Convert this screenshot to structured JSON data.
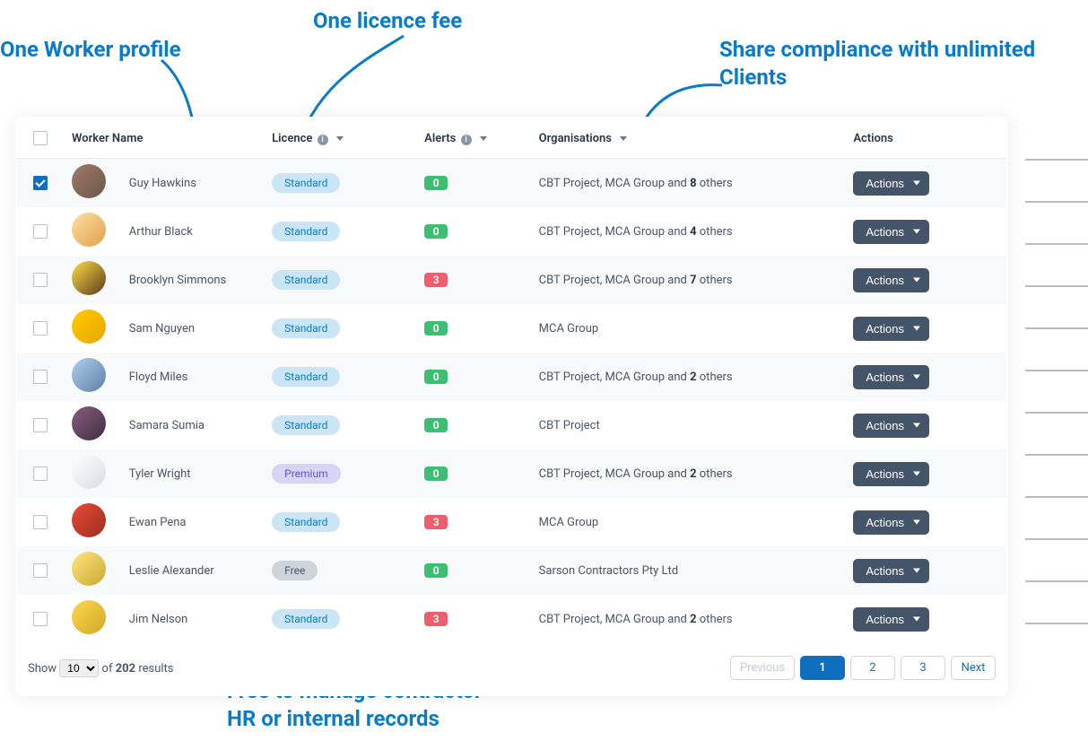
{
  "annotations": {
    "worker_profile": "One Worker profile",
    "licence_fee": "One licence fee",
    "share": "Share compliance with unlimited Clients",
    "free_line1": "Free to manage contractor",
    "free_line2": "HR or internal records"
  },
  "columns": {
    "name": "Worker Name",
    "licence": "Licence",
    "alerts": "Alerts",
    "orgs": "Organisations",
    "actions": "Actions"
  },
  "labels": {
    "actions_btn": "Actions",
    "show": "Show",
    "of": "of",
    "results": "results",
    "prev": "Previous",
    "next": "Next"
  },
  "licence_text": {
    "standard": "Standard",
    "premium": "Premium",
    "free": "Free"
  },
  "footer": {
    "page_size": "10",
    "total": "202",
    "pages": [
      "1",
      "2",
      "3"
    ]
  },
  "rows": [
    {
      "checked": true,
      "avatar": "av1",
      "name": "Guy Hawkins",
      "licence": "standard",
      "alerts": "0",
      "alert_style": "green",
      "org_prefix": "CBT Project, MCA Group and ",
      "org_bold": "8",
      "org_suffix": " others"
    },
    {
      "checked": false,
      "avatar": "av2",
      "name": "Arthur Black",
      "licence": "standard",
      "alerts": "0",
      "alert_style": "green",
      "org_prefix": "CBT Project, MCA Group and ",
      "org_bold": "4",
      "org_suffix": " others"
    },
    {
      "checked": false,
      "avatar": "av3",
      "name": "Brooklyn Simmons",
      "licence": "standard",
      "alerts": "3",
      "alert_style": "red",
      "org_prefix": "CBT Project, MCA Group and ",
      "org_bold": "7",
      "org_suffix": " others"
    },
    {
      "checked": false,
      "avatar": "av4",
      "name": "Sam Nguyen",
      "licence": "standard",
      "alerts": "0",
      "alert_style": "green",
      "org_prefix": "MCA Group",
      "org_bold": "",
      "org_suffix": ""
    },
    {
      "checked": false,
      "avatar": "av5",
      "name": "Floyd Miles",
      "licence": "standard",
      "alerts": "0",
      "alert_style": "green",
      "org_prefix": "CBT Project, MCA Group and ",
      "org_bold": "2",
      "org_suffix": " others"
    },
    {
      "checked": false,
      "avatar": "av6",
      "name": "Samara Sumia",
      "licence": "standard",
      "alerts": "0",
      "alert_style": "green",
      "org_prefix": "CBT Project",
      "org_bold": "",
      "org_suffix": ""
    },
    {
      "checked": false,
      "avatar": "av7",
      "name": "Tyler Wright",
      "licence": "premium",
      "alerts": "0",
      "alert_style": "green",
      "org_prefix": "CBT Project, MCA Group and ",
      "org_bold": "2",
      "org_suffix": " others"
    },
    {
      "checked": false,
      "avatar": "av8",
      "name": "Ewan Pena",
      "licence": "standard",
      "alerts": "3",
      "alert_style": "red",
      "org_prefix": "MCA Group",
      "org_bold": "",
      "org_suffix": ""
    },
    {
      "checked": false,
      "avatar": "av9",
      "name": "Leslie Alexander",
      "licence": "free",
      "alerts": "0",
      "alert_style": "green",
      "org_prefix": "Sarson Contractors Pty Ltd",
      "org_bold": "",
      "org_suffix": ""
    },
    {
      "checked": false,
      "avatar": "av10",
      "name": "Jim Nelson",
      "licence": "standard",
      "alerts": "3",
      "alert_style": "red",
      "org_prefix": "CBT Project, MCA Group and ",
      "org_bold": "2",
      "org_suffix": " others"
    }
  ]
}
